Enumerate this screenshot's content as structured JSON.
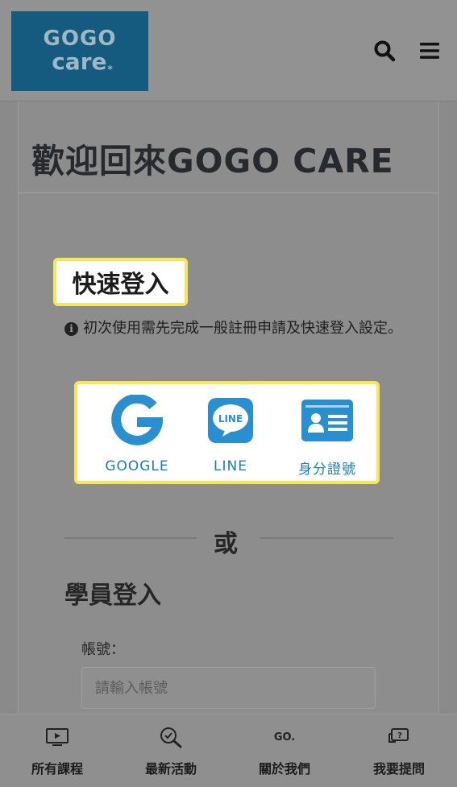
{
  "header": {
    "logo_line1": "GOGO",
    "logo_line2": "care",
    "logo_mark": "*",
    "icons": [
      "search-icon",
      "menu-icon"
    ]
  },
  "page_title": "歡迎回來GOGO CARE",
  "quick_login": {
    "title": "快速登入",
    "notice": "初次使用需先完成一般註冊申請及快速登入設定。",
    "providers": [
      {
        "label": "GOOGLE",
        "icon": "google-icon"
      },
      {
        "label": "LINE",
        "icon": "line-icon"
      },
      {
        "label": "身分證號",
        "icon": "id-card-icon"
      }
    ],
    "highlight_color": "#f6e75a"
  },
  "divider_text": "或",
  "student_login": {
    "title": "學員登入",
    "account_label": "帳號：",
    "account_placeholder": "請輸入帳號"
  },
  "bottom_nav": [
    {
      "label": "所有課程",
      "icon": "tv-play-icon"
    },
    {
      "label": "最新活動",
      "icon": "magnifier-check-icon"
    },
    {
      "label": "關於我們",
      "icon": "go-logo-icon",
      "icon_text": "GO."
    },
    {
      "label": "我要提問",
      "icon": "question-chat-icon"
    }
  ],
  "colors": {
    "brand_blue": "#155b80",
    "link_blue": "#1a7db5",
    "overlay_gray": "#8a8a8a"
  }
}
